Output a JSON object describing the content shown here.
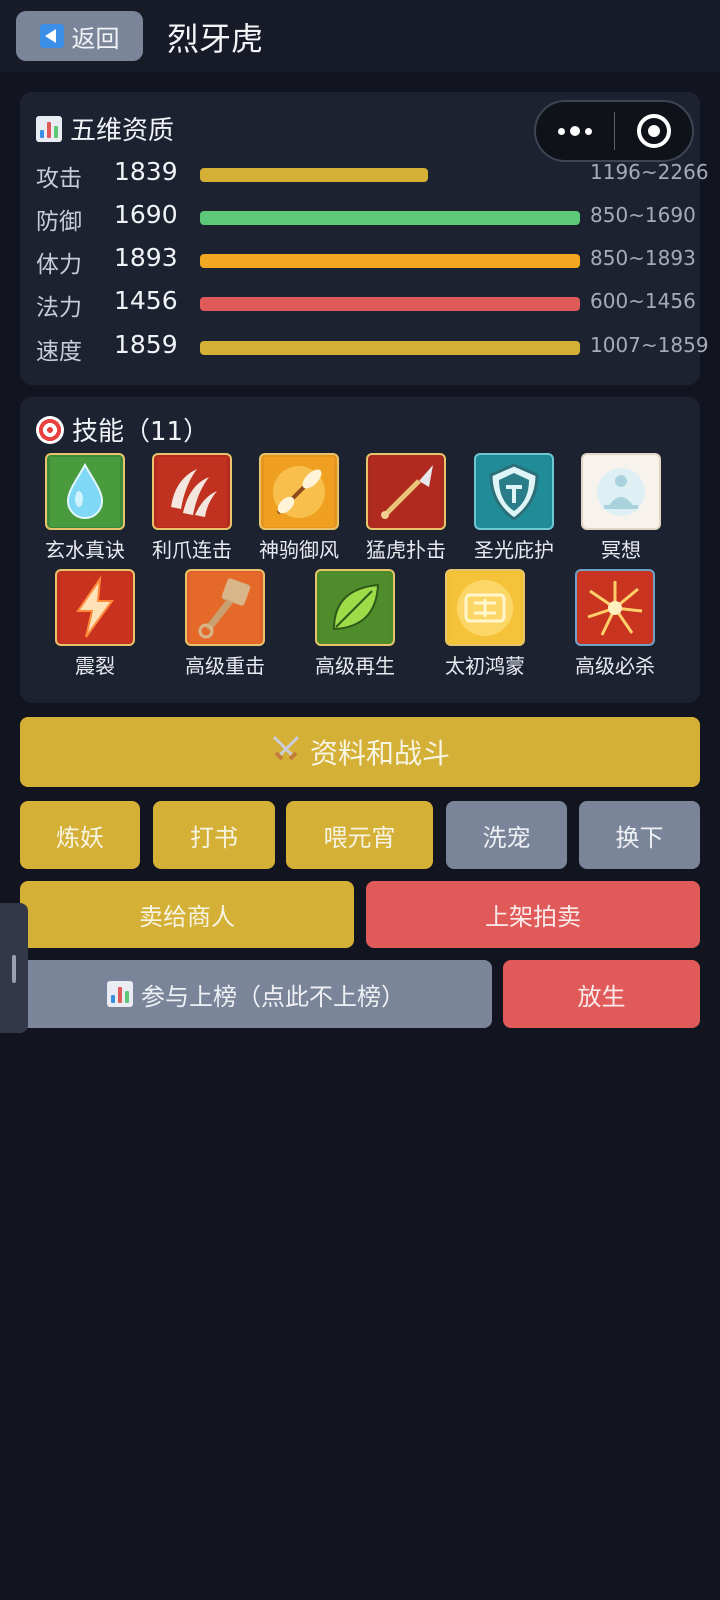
{
  "header": {
    "back_label": "返回",
    "title": "烈牙虎"
  },
  "stats_card": {
    "title": "五维资质",
    "stats": [
      {
        "label": "攻击",
        "value": "1839",
        "range": "1196~2266",
        "fill": 0.6,
        "color": "#d4b036"
      },
      {
        "label": "防御",
        "value": "1690",
        "range": "850~1690",
        "fill": 1.0,
        "color": "#5cc878"
      },
      {
        "label": "体力",
        "value": "1893",
        "range": "850~1893",
        "fill": 1.0,
        "color": "#f1a722"
      },
      {
        "label": "法力",
        "value": "1456",
        "range": "600~1456",
        "fill": 1.0,
        "color": "#e05a5a"
      },
      {
        "label": "速度",
        "value": "1859",
        "range": "1007~1859",
        "fill": 1.0,
        "color": "#d4b036"
      }
    ]
  },
  "skills_card": {
    "title": "技能（11）",
    "skills": [
      {
        "label": "玄水真诀",
        "icon": "water-drop-icon"
      },
      {
        "label": "利爪连击",
        "icon": "claw-icon"
      },
      {
        "label": "神驹御风",
        "icon": "feather-wind-icon"
      },
      {
        "label": "猛虎扑击",
        "icon": "spear-icon"
      },
      {
        "label": "圣光庇护",
        "icon": "shield-icon"
      },
      {
        "label": "冥想",
        "icon": "meditation-icon"
      },
      {
        "label": "震裂",
        "icon": "lightning-icon"
      },
      {
        "label": "高级重击",
        "icon": "hammer-icon"
      },
      {
        "label": "高级再生",
        "icon": "leaf-icon"
      },
      {
        "label": "太初鸿蒙",
        "icon": "fortune-icon"
      },
      {
        "label": "高级必杀",
        "icon": "burst-icon"
      }
    ]
  },
  "actions": {
    "battle": "资料和战斗",
    "refine": "炼妖",
    "book": "打书",
    "feed": "喂元宵",
    "wash": "洗宠",
    "swap": "换下",
    "sell_merchant": "卖给商人",
    "auction": "上架拍卖",
    "ranking": "参与上榜（点此不上榜）",
    "release": "放生"
  }
}
